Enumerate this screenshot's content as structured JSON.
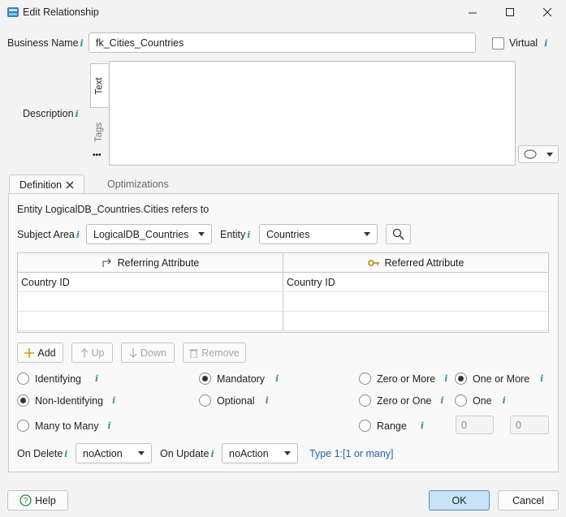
{
  "window": {
    "title": "Edit Relationship"
  },
  "header": {
    "business_name_label": "Business Name",
    "business_name_value": "fk_Cities_Countries",
    "virtual_label": "Virtual",
    "description_label": "Description",
    "desc_tabs": [
      "Text",
      "Tags"
    ],
    "more_glyph": "•••"
  },
  "tabs": [
    {
      "label": "Definition"
    },
    {
      "label": "Optimizations"
    }
  ],
  "definition": {
    "refers_text": "Entity LogicalDB_Countries.Cities refers to",
    "subject_area_label": "Subject Area",
    "subject_area_value": "LogicalDB_Countries",
    "entity_label": "Entity",
    "entity_value": "Countries"
  },
  "grid": {
    "columns": [
      "Referring Attribute",
      "Referred Attribute"
    ],
    "rows": [
      [
        "Country ID",
        "Country ID"
      ],
      [
        "",
        ""
      ],
      [
        "",
        ""
      ]
    ]
  },
  "toolbar": {
    "add": "Add",
    "up": "Up",
    "down": "Down",
    "remove": "Remove"
  },
  "radios": {
    "identifying": "Identifying",
    "non_identifying": "Non-Identifying",
    "many_to_many": "Many to Many",
    "mandatory": "Mandatory",
    "optional": "Optional",
    "zero_or_more": "Zero or More",
    "zero_or_one": "Zero or One",
    "range": "Range",
    "one_or_more": "One or More",
    "one": "One",
    "range_from": "0",
    "range_to": "0"
  },
  "actions": {
    "on_delete_label": "On Delete",
    "on_delete_value": "noAction",
    "on_update_label": "On Update",
    "on_update_value": "noAction",
    "type_text": "Type 1:[1 or many]"
  },
  "footer": {
    "help": "Help",
    "ok": "OK",
    "cancel": "Cancel"
  },
  "colors": {
    "accent": "#4a90c8",
    "info": "#3a8fb0",
    "link": "#2b5ea6"
  }
}
